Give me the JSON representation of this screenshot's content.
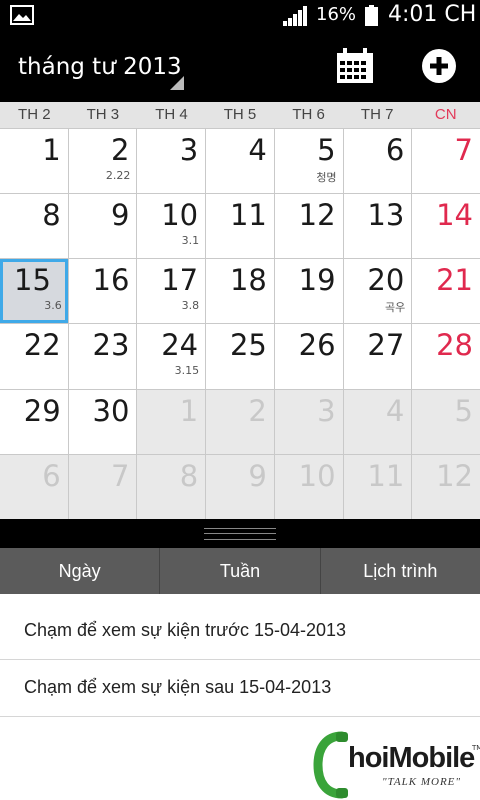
{
  "status_bar": {
    "battery": "16%",
    "time": "4:01 CH",
    "icons": [
      "gallery-icon",
      "signal-icon",
      "battery-icon"
    ]
  },
  "app_bar": {
    "month_title": "tháng tư 2013",
    "actions": [
      "calendar-icon",
      "add-icon"
    ]
  },
  "weekdays": [
    "TH 2",
    "TH 3",
    "TH 4",
    "TH 5",
    "TH 6",
    "TH 7",
    "CN"
  ],
  "weeks": [
    [
      {
        "d": "1"
      },
      {
        "d": "2",
        "s": "2.22"
      },
      {
        "d": "3"
      },
      {
        "d": "4"
      },
      {
        "d": "5",
        "s": "청명"
      },
      {
        "d": "6"
      },
      {
        "d": "7",
        "sun": true
      }
    ],
    [
      {
        "d": "8"
      },
      {
        "d": "9"
      },
      {
        "d": "10",
        "s": "3.1"
      },
      {
        "d": "11"
      },
      {
        "d": "12"
      },
      {
        "d": "13"
      },
      {
        "d": "14",
        "sun": true
      }
    ],
    [
      {
        "d": "15",
        "s": "3.6",
        "today": true
      },
      {
        "d": "16"
      },
      {
        "d": "17",
        "s": "3.8"
      },
      {
        "d": "18"
      },
      {
        "d": "19"
      },
      {
        "d": "20",
        "s": "곡우"
      },
      {
        "d": "21",
        "sun": true
      }
    ],
    [
      {
        "d": "22"
      },
      {
        "d": "23"
      },
      {
        "d": "24",
        "s": "3.15"
      },
      {
        "d": "25"
      },
      {
        "d": "26"
      },
      {
        "d": "27"
      },
      {
        "d": "28",
        "sun": true
      }
    ],
    [
      {
        "d": "29"
      },
      {
        "d": "30"
      },
      {
        "d": "1",
        "other": true
      },
      {
        "d": "2",
        "other": true
      },
      {
        "d": "3",
        "other": true
      },
      {
        "d": "4",
        "other": true
      },
      {
        "d": "5",
        "other": true,
        "sun": true
      }
    ],
    [
      {
        "d": "6",
        "other": true
      },
      {
        "d": "7",
        "other": true
      },
      {
        "d": "8",
        "other": true
      },
      {
        "d": "9",
        "other": true
      },
      {
        "d": "10",
        "other": true
      },
      {
        "d": "11",
        "other": true
      },
      {
        "d": "12",
        "other": true,
        "sun": true
      }
    ]
  ],
  "view_tabs": [
    "Ngày",
    "Tuần",
    "Lịch trình"
  ],
  "event_links": {
    "previous": "Chạm để xem sự kiện trước 15-04-2013",
    "next": "Chạm để xem sự kiện sau 15-04-2013"
  },
  "watermark": {
    "logo": "hoiMobile",
    "tagline": "\"TALK MORE\"",
    "tm": "TM"
  },
  "colors": {
    "sunday": "#e0294e",
    "today_border": "#3fa9e8",
    "today_bg": "#d6d9de",
    "other_month_bg": "#e9e9e9",
    "tab_bar": "#5b5b5b"
  }
}
